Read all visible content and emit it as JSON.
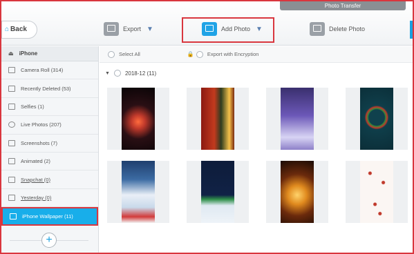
{
  "window": {
    "title": "Photo Transfer"
  },
  "toolbar": {
    "back_label": "Back",
    "export_label": "Export",
    "add_photo_label": "Add Photo",
    "delete_photo_label": "Delete Photo"
  },
  "sidebar": {
    "device": "iPhone",
    "items": [
      {
        "label": "Camera Roll (314)",
        "icon": "camera-icon"
      },
      {
        "label": "Recently Deleted (53)",
        "icon": "trash-icon"
      },
      {
        "label": "Selfies (1)",
        "icon": "person-icon"
      },
      {
        "label": "Live Photos (207)",
        "icon": "live-icon"
      },
      {
        "label": "Screenshots (7)",
        "icon": "screenshot-icon"
      },
      {
        "label": "Animated (2)",
        "icon": "animated-icon"
      },
      {
        "label": "Snapchat (0)",
        "icon": "album-icon"
      },
      {
        "label": "Yesterday (0)",
        "icon": "album-icon"
      },
      {
        "label": "iPhone Wallpaper (11)",
        "icon": "album-icon"
      }
    ]
  },
  "content": {
    "select_all": "Select All",
    "export_encryption": "Export with Encryption",
    "group_label": "2018-12  (11)"
  },
  "thumbnails": [
    {
      "name": "christmas-tree-bokeh"
    },
    {
      "name": "red-door-tree"
    },
    {
      "name": "snowy-purple-trees"
    },
    {
      "name": "merry-christmas-wreath"
    },
    {
      "name": "snowman-village"
    },
    {
      "name": "navy-trees"
    },
    {
      "name": "golden-tree-lights"
    },
    {
      "name": "christmas-red-hearts"
    }
  ],
  "colors": {
    "accent": "#18aeea",
    "highlight": "#d9363e"
  }
}
